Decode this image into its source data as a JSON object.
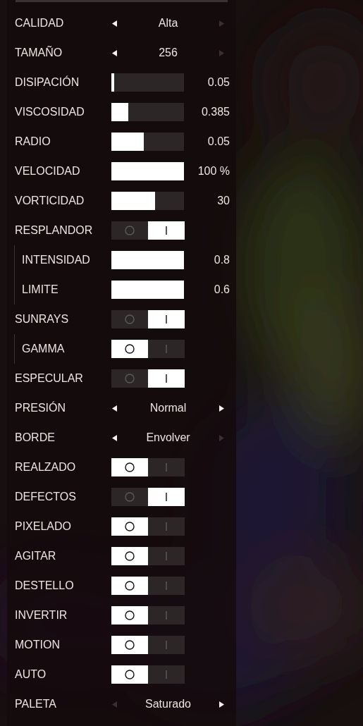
{
  "settings": [
    {
      "kind": "select",
      "label": "CALIDAD",
      "value": "Alta",
      "prev_disabled": false,
      "next_disabled": true
    },
    {
      "kind": "select",
      "label": "TAMAÑO",
      "value": "256",
      "prev_disabled": false,
      "next_disabled": true
    },
    {
      "kind": "slider",
      "label": "DISIPACIÓN",
      "level": 0.04,
      "reading": "0.05"
    },
    {
      "kind": "slider",
      "label": "VISCOSIDAD",
      "level": 0.23,
      "reading": "0.385"
    },
    {
      "kind": "slider",
      "label": "RADIO",
      "level": 0.45,
      "reading": "0.05"
    },
    {
      "kind": "slider",
      "label": "VELOCIDAD",
      "level": 1,
      "reading": "100 %"
    },
    {
      "kind": "slider",
      "label": "VORTICIDAD",
      "level": 0.6,
      "reading": "30"
    },
    {
      "kind": "toggle",
      "label": "RESPLANDOR",
      "on": true,
      "children": [
        {
          "kind": "slider",
          "label": "INTENSIDAD",
          "level": 1,
          "reading": "0.8"
        },
        {
          "kind": "slider",
          "label": "LIMITE",
          "level": 1,
          "reading": "0.6"
        }
      ]
    },
    {
      "kind": "toggle",
      "label": "SUNRAYS",
      "on": true,
      "children": [
        {
          "kind": "toggle",
          "label": "GAMMA",
          "on": false
        }
      ]
    },
    {
      "kind": "toggle",
      "label": "ESPECULAR",
      "on": true
    },
    {
      "kind": "select",
      "label": "PRESIÓN",
      "value": "Normal",
      "prev_disabled": false,
      "next_disabled": false
    },
    {
      "kind": "select",
      "label": "BORDE",
      "value": "Envolver",
      "prev_disabled": false,
      "next_disabled": true
    },
    {
      "kind": "toggle",
      "label": "REALZADO",
      "on": false
    },
    {
      "kind": "toggle",
      "label": "DEFECTOS",
      "on": true
    },
    {
      "kind": "toggle",
      "label": "PIXELADO",
      "on": false
    },
    {
      "kind": "toggle",
      "label": "AGITAR",
      "on": false
    },
    {
      "kind": "toggle",
      "label": "DESTELLO",
      "on": false
    },
    {
      "kind": "toggle",
      "label": "INVERTIR",
      "on": false
    },
    {
      "kind": "toggle",
      "label": "MOTION",
      "on": false
    },
    {
      "kind": "toggle",
      "label": "AUTO",
      "on": false
    },
    {
      "kind": "select",
      "label": "PALETA",
      "value": "Saturado",
      "prev_disabled": true,
      "next_disabled": false
    }
  ]
}
